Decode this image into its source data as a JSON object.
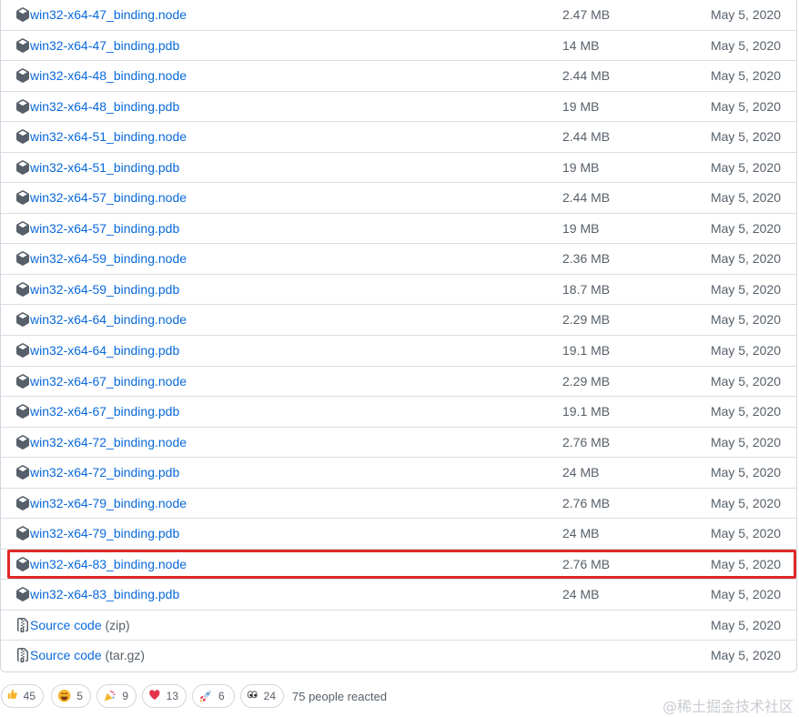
{
  "assets": [
    {
      "name": "win32-x64-47_binding.node",
      "size": "2.47 MB",
      "date": "May 5, 2020",
      "icon": "package-icon"
    },
    {
      "name": "win32-x64-47_binding.pdb",
      "size": "14 MB",
      "date": "May 5, 2020",
      "icon": "package-icon"
    },
    {
      "name": "win32-x64-48_binding.node",
      "size": "2.44 MB",
      "date": "May 5, 2020",
      "icon": "package-icon"
    },
    {
      "name": "win32-x64-48_binding.pdb",
      "size": "19 MB",
      "date": "May 5, 2020",
      "icon": "package-icon"
    },
    {
      "name": "win32-x64-51_binding.node",
      "size": "2.44 MB",
      "date": "May 5, 2020",
      "icon": "package-icon"
    },
    {
      "name": "win32-x64-51_binding.pdb",
      "size": "19 MB",
      "date": "May 5, 2020",
      "icon": "package-icon"
    },
    {
      "name": "win32-x64-57_binding.node",
      "size": "2.44 MB",
      "date": "May 5, 2020",
      "icon": "package-icon"
    },
    {
      "name": "win32-x64-57_binding.pdb",
      "size": "19 MB",
      "date": "May 5, 2020",
      "icon": "package-icon"
    },
    {
      "name": "win32-x64-59_binding.node",
      "size": "2.36 MB",
      "date": "May 5, 2020",
      "icon": "package-icon"
    },
    {
      "name": "win32-x64-59_binding.pdb",
      "size": "18.7 MB",
      "date": "May 5, 2020",
      "icon": "package-icon"
    },
    {
      "name": "win32-x64-64_binding.node",
      "size": "2.29 MB",
      "date": "May 5, 2020",
      "icon": "package-icon"
    },
    {
      "name": "win32-x64-64_binding.pdb",
      "size": "19.1 MB",
      "date": "May 5, 2020",
      "icon": "package-icon"
    },
    {
      "name": "win32-x64-67_binding.node",
      "size": "2.29 MB",
      "date": "May 5, 2020",
      "icon": "package-icon"
    },
    {
      "name": "win32-x64-67_binding.pdb",
      "size": "19.1 MB",
      "date": "May 5, 2020",
      "icon": "package-icon"
    },
    {
      "name": "win32-x64-72_binding.node",
      "size": "2.76 MB",
      "date": "May 5, 2020",
      "icon": "package-icon"
    },
    {
      "name": "win32-x64-72_binding.pdb",
      "size": "24 MB",
      "date": "May 5, 2020",
      "icon": "package-icon"
    },
    {
      "name": "win32-x64-79_binding.node",
      "size": "2.76 MB",
      "date": "May 5, 2020",
      "icon": "package-icon"
    },
    {
      "name": "win32-x64-79_binding.pdb",
      "size": "24 MB",
      "date": "May 5, 2020",
      "icon": "package-icon"
    },
    {
      "name": "win32-x64-83_binding.node",
      "size": "2.76 MB",
      "date": "May 5, 2020",
      "icon": "package-icon",
      "highlighted": true
    },
    {
      "name": "win32-x64-83_binding.pdb",
      "size": "24 MB",
      "date": "May 5, 2020",
      "icon": "package-icon"
    },
    {
      "name": "Source code",
      "suffix": " (zip)",
      "size": "",
      "date": "May 5, 2020",
      "icon": "file-zip-icon"
    },
    {
      "name": "Source code",
      "suffix": " (tar.gz)",
      "size": "",
      "date": "May 5, 2020",
      "icon": "file-zip-icon"
    }
  ],
  "reactions": [
    {
      "emoji": "thumbs-up-icon",
      "count": "45"
    },
    {
      "emoji": "laugh-icon",
      "count": "5"
    },
    {
      "emoji": "hooray-icon",
      "count": "9"
    },
    {
      "emoji": "heart-icon",
      "count": "13"
    },
    {
      "emoji": "rocket-icon",
      "count": "6"
    },
    {
      "emoji": "eyes-icon",
      "count": "24"
    }
  ],
  "reacted_text": "75 people reacted",
  "watermark": "@稀土掘金技术社区",
  "colors": {
    "link": "#0969da",
    "muted": "#57606a",
    "border": "#d0d7de",
    "highlight": "#e02828"
  }
}
